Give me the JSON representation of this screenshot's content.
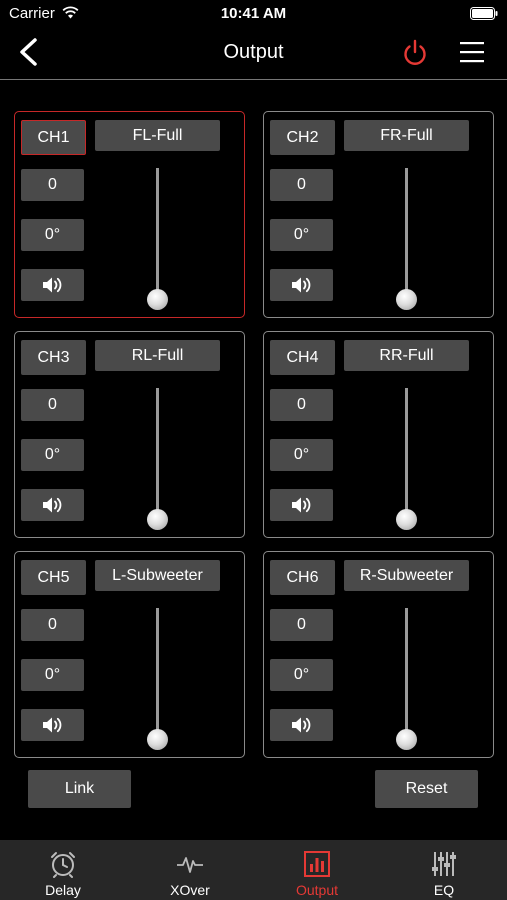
{
  "status_bar": {
    "carrier": "Carrier",
    "time": "10:41 AM"
  },
  "nav": {
    "title": "Output",
    "power_color": "#e53935"
  },
  "channels": [
    {
      "ch": "CH1",
      "name": "FL-Full",
      "gain": "0",
      "phase": "0°",
      "fader_level": 0,
      "selected": true
    },
    {
      "ch": "CH2",
      "name": "FR-Full",
      "gain": "0",
      "phase": "0°",
      "fader_level": 0,
      "selected": false
    },
    {
      "ch": "CH3",
      "name": "RL-Full",
      "gain": "0",
      "phase": "0°",
      "fader_level": 0,
      "selected": false
    },
    {
      "ch": "CH4",
      "name": "RR-Full",
      "gain": "0",
      "phase": "0°",
      "fader_level": 0,
      "selected": false
    },
    {
      "ch": "CH5",
      "name": "L-Subweeter",
      "gain": "0",
      "phase": "0°",
      "fader_level": 0,
      "selected": false
    },
    {
      "ch": "CH6",
      "name": "R-Subweeter",
      "gain": "0",
      "phase": "0°",
      "fader_level": 0,
      "selected": false
    }
  ],
  "buttons": {
    "link": "Link",
    "reset": "Reset"
  },
  "tabs": [
    {
      "label": "Delay",
      "icon": "alarm-clock-icon",
      "active": false
    },
    {
      "label": "XOver",
      "icon": "waveform-icon",
      "active": false
    },
    {
      "label": "Output",
      "icon": "bar-chart-icon",
      "active": true
    },
    {
      "label": "EQ",
      "icon": "sliders-icon",
      "active": false
    }
  ],
  "accent_color": "#e53935"
}
